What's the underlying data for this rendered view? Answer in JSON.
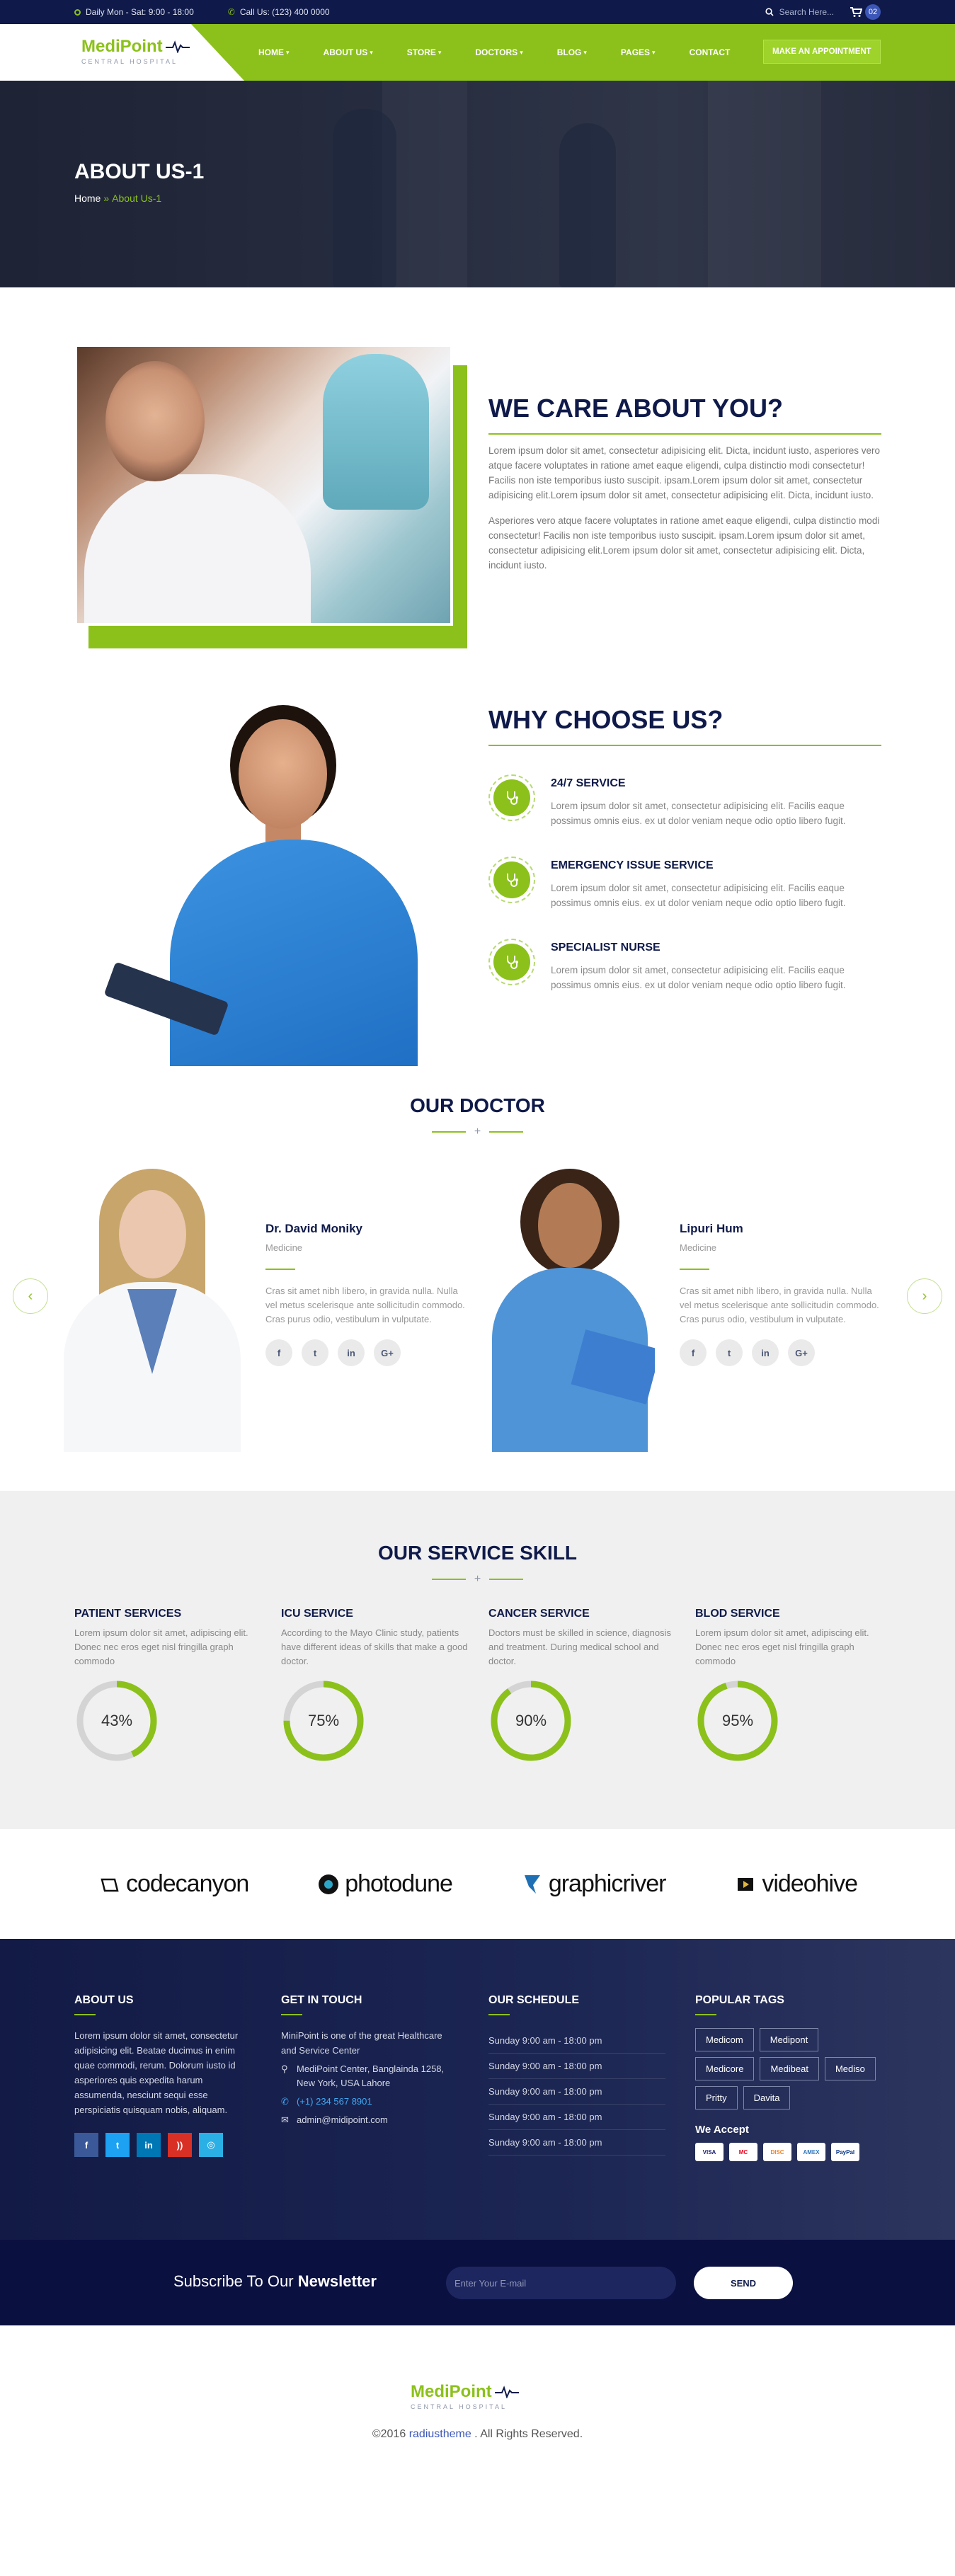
{
  "topbar": {
    "hours": "Daily Mon - Sat: 9:00 - 18:00",
    "phone": "Call Us: (123) 400 0000",
    "search_placeholder": "Search Here...",
    "cart_count": "02"
  },
  "logo": {
    "name": "MediPoint",
    "sub": "CENTRAL HOSPITAL"
  },
  "nav": {
    "items": [
      "HOME",
      "ABOUT US",
      "STORE",
      "DOCTORS",
      "BLOG",
      "PAGES",
      "CONTACT"
    ],
    "appointment": "MAKE AN APPOINTMENT"
  },
  "hero": {
    "title": "ABOUT US-1",
    "crumb_home": "Home",
    "crumb_sep": "»",
    "crumb_current": "About Us-1"
  },
  "care": {
    "title": "WE CARE ABOUT YOU?",
    "p1": "Lorem ipsum dolor sit amet, consectetur adipisicing elit. Dicta, incidunt iusto, asperiores vero atque facere voluptates in ratione amet eaque eligendi, culpa distinctio modi consectetur! Facilis non iste temporibus iusto suscipit. ipsam.Lorem ipsum dolor sit amet, consectetur adipisicing elit.Lorem ipsum dolor sit amet, consectetur adipisicing elit. Dicta, incidunt iusto.",
    "p2": "Asperiores vero atque facere voluptates in ratione amet eaque eligendi, culpa distinctio modi consectetur! Facilis non iste temporibus iusto suscipit. ipsam.Lorem ipsum dolor sit amet, consectetur adipisicing elit.Lorem ipsum dolor sit amet, consectetur adipisicing elit. Dicta, incidunt iusto."
  },
  "why": {
    "title": "WHY CHOOSE US?",
    "features": [
      {
        "title": "24/7 SERVICE",
        "text": "Lorem ipsum dolor sit amet, consectetur adipisicing elit. Facilis eaque possimus omnis eius. ex ut dolor veniam neque odio optio libero fugit."
      },
      {
        "title": "EMERGENCY ISSUE SERVICE",
        "text": "Lorem ipsum dolor sit amet, consectetur adipisicing elit. Facilis eaque possimus omnis eius. ex ut dolor veniam neque odio optio libero fugit."
      },
      {
        "title": "SPECIALIST NURSE",
        "text": "Lorem ipsum dolor sit amet, consectetur adipisicing elit. Facilis eaque possimus omnis eius. ex ut dolor veniam neque odio optio libero fugit."
      }
    ]
  },
  "doctors": {
    "title": "OUR DOCTOR",
    "list": [
      {
        "name": "Dr. David Moniky",
        "role": "Medicine",
        "bio": "Cras sit amet nibh libero, in gravida nulla. Nulla vel metus scelerisque ante sollicitudin commodo. Cras purus odio, vestibulum in vulputate."
      },
      {
        "name": "Lipuri Hum",
        "role": "Medicine",
        "bio": "Cras sit amet nibh libero, in gravida nulla. Nulla vel metus scelerisque ante sollicitudin commodo. Cras purus odio, vestibulum in vulputate."
      }
    ],
    "social": [
      "f",
      "t",
      "in",
      "G+"
    ]
  },
  "skills": {
    "title": "OUR SERVICE SKILL",
    "items": [
      {
        "title": "PATIENT SERVICES",
        "text": "Lorem ipsum dolor sit amet, adipiscing elit. Donec nec eros eget nisl fringilla graph commodo",
        "percent": 43,
        "label": "43%"
      },
      {
        "title": "ICU SERVICE",
        "text": "According to the Mayo Clinic study, patients have different ideas of skills that make a good doctor.",
        "percent": 75,
        "label": "75%"
      },
      {
        "title": "CANCER SERVICE",
        "text": "Doctors must be skilled in science, diagnosis and treatment. During medical school and doctor.",
        "percent": 90,
        "label": "90%"
      },
      {
        "title": "BLOD SERVICE",
        "text": "Lorem ipsum dolor sit amet, adipiscing elit. Donec nec eros eget nisl fringilla graph commodo",
        "percent": 95,
        "label": "95%"
      }
    ],
    "colors": {
      "fill": "#8cc11b",
      "track": "#d4d4d4"
    }
  },
  "brands": [
    "codecanyon",
    "photodune",
    "graphicriver",
    "videohive"
  ],
  "footer": {
    "about": {
      "title": "ABOUT US",
      "text": "Lorem ipsum dolor sit amet, consectetur adipisicing elit. Beatae ducimus in enim quae commodi, rerum. Dolorum iusto id asperiores quis expedita harum assumenda, nesciunt sequi esse perspiciatis quisquam nobis, aliquam."
    },
    "contact": {
      "title": "GET IN TOUCH",
      "intro": "MiniPoint is one of the great Healthcare and Service Center",
      "address": "MediPoint Center, Banglainda 1258, New York, USA Lahore",
      "phone": "(+1) 234 567 8901",
      "email": "admin@midipoint.com"
    },
    "schedule": {
      "title": "OUR SCHEDULE",
      "rows": [
        "Sunday 9:00 am - 18:00 pm",
        "Sunday 9:00 am - 18:00 pm",
        "Sunday 9:00 am - 18:00 pm",
        "Sunday 9:00 am - 18:00 pm",
        "Sunday 9:00 am - 18:00 pm"
      ]
    },
    "tags": {
      "title": "POPULAR TAGS",
      "list": [
        "Medicom",
        "Medipont",
        "Medicore",
        "Medibeat",
        "Mediso",
        "Pritty",
        "Davita"
      ],
      "accept": "We Accept",
      "cards": [
        "VISA",
        "MC",
        "DISC",
        "AMEX",
        "PayPal"
      ]
    }
  },
  "newsletter": {
    "prefix": "Subscribe To Our ",
    "bold": "Newsletter",
    "placeholder": "Enter Your E-mail",
    "button": "SEND"
  },
  "bottom": {
    "copy_prefix": "©2016 ",
    "brand": "radiustheme",
    "copy_suffix": " . All Rights Reserved."
  }
}
